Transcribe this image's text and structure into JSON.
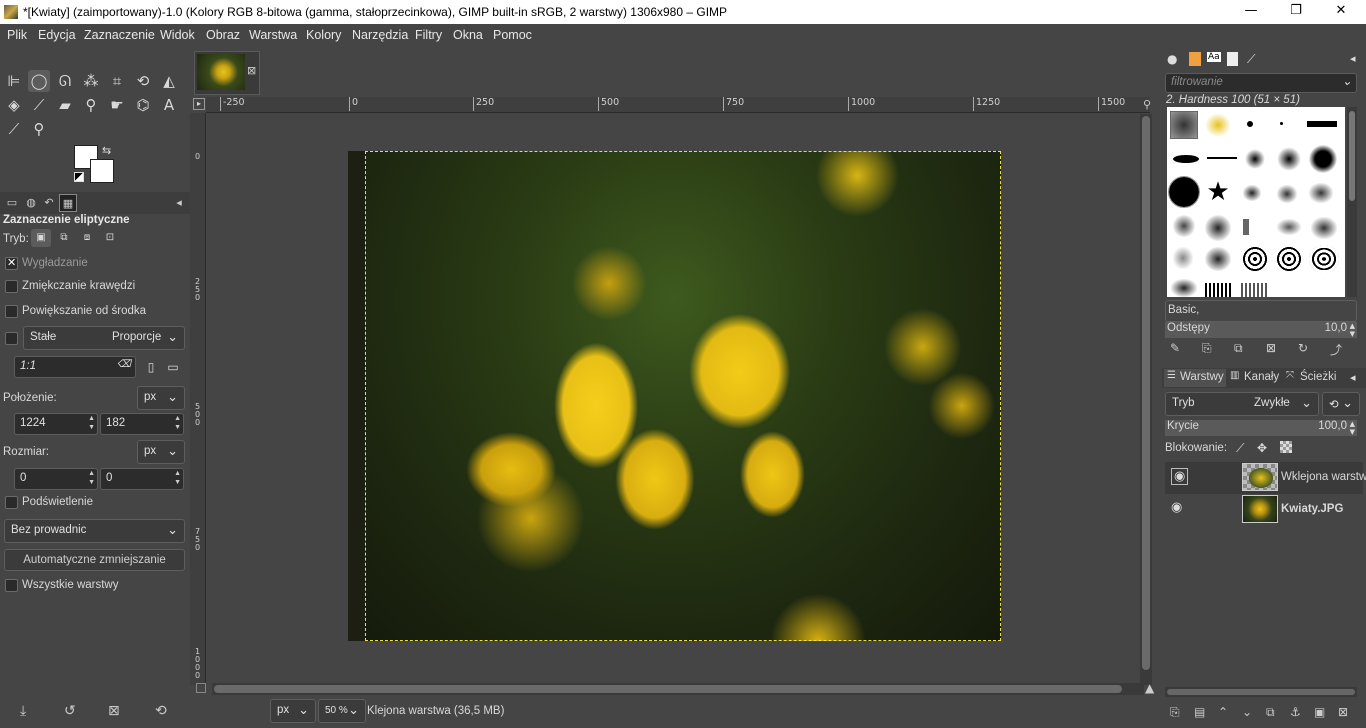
{
  "window": {
    "title": "*[Kwiaty] (zaimportowany)-1.0 (Kolory RGB 8-bitowa (gamma, stałoprzecinkowa), GIMP built-in sRGB, 2 warstwy) 1306x980 – GIMP",
    "minimize": "—",
    "maximize": "❐",
    "close": "✕"
  },
  "menu": [
    "Plik",
    "Edycja",
    "Zaznaczenie",
    "Widok",
    "Obraz",
    "Warstwa",
    "Kolory",
    "Narzędzia",
    "Filtry",
    "Okna",
    "Pomoc"
  ],
  "tool_options": {
    "title": "Zaznaczenie eliptyczne",
    "mode_label": "Tryb:",
    "antialias": "Wygładzanie",
    "feather": "Zmiękczanie krawędzi",
    "expand_center": "Powiększanie od środka",
    "fixed": "Stałe",
    "fixed_value": "Proporcje",
    "ratio": "1:1",
    "position_label": "Położenie:",
    "position_unit": "px",
    "pos_x": "1224",
    "pos_y": "182",
    "size_label": "Rozmiar:",
    "size_unit": "px",
    "size_w": "0",
    "size_h": "0",
    "highlight": "Podświetlenie",
    "guides": "Bez prowadnic",
    "auto_shrink": "Automatyczne zmniejszanie",
    "all_layers": "Wszystkie warstwy"
  },
  "ruler": {
    "h": [
      "-250",
      "0",
      "250",
      "500",
      "750",
      "1000",
      "1250",
      "1500"
    ],
    "v": [
      "0",
      "250",
      "500",
      "750",
      "1000"
    ]
  },
  "status": {
    "unit": "px",
    "zoom": "50 %",
    "text": "Klejona warstwa (36,5 MB)"
  },
  "brushes": {
    "filter_placeholder": "filtrowanie",
    "current": "2. Hardness 100 (51 × 51)",
    "preset": "Basic,",
    "spacing_label": "Odstępy",
    "spacing_value": "10,0"
  },
  "layers": {
    "tab_layers": "Warstwy",
    "tab_channels": "Kanały",
    "tab_paths": "Ścieżki",
    "mode_label": "Tryb",
    "mode_value": "Zwykłe",
    "opacity_label": "Krycie",
    "opacity_value": "100,0",
    "lock_label": "Blokowanie:",
    "items": [
      {
        "name": "Wklejona warstwa"
      },
      {
        "name": "Kwiaty.JPG"
      }
    ]
  },
  "colors": {
    "accent": "#f0e040",
    "bg": "#454545"
  }
}
